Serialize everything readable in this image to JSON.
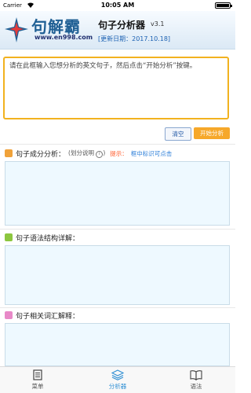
{
  "status_bar": {
    "carrier": "Carrier",
    "time": "10:05 AM"
  },
  "header": {
    "logo_text": "句解霸",
    "logo_url": "www.en998.com",
    "app_title": "句子分析器",
    "version": "v3.1",
    "update_date": "[更新日期：2017.10.18]"
  },
  "input": {
    "placeholder_text": "请在此框输入您想分析的英文句子，然后点击“开始分析”按键。"
  },
  "buttons": {
    "clear": "清空",
    "start": "开始分析"
  },
  "sections": {
    "component": {
      "title": "句子成分分析：",
      "note": "(划分说明",
      "note_end": ")",
      "tip_label": "提示：",
      "tip_text": "框中标识可点击",
      "icon_color": "#f0a23a"
    },
    "structure": {
      "title": "句子语法结构详解：",
      "icon_color": "#8cc63f"
    },
    "vocab": {
      "title": "句子相关词汇解释：",
      "icon_color": "#e889c8"
    }
  },
  "tabs": [
    {
      "label": "菜单",
      "icon": "menu-icon",
      "active": false
    },
    {
      "label": "分析器",
      "icon": "layers-icon",
      "active": true
    },
    {
      "label": "语法",
      "icon": "book-icon",
      "active": false
    }
  ],
  "colors": {
    "accent_orange": "#f6a82a",
    "accent_blue": "#2f8fd4",
    "result_bg": "#eef9ff"
  }
}
